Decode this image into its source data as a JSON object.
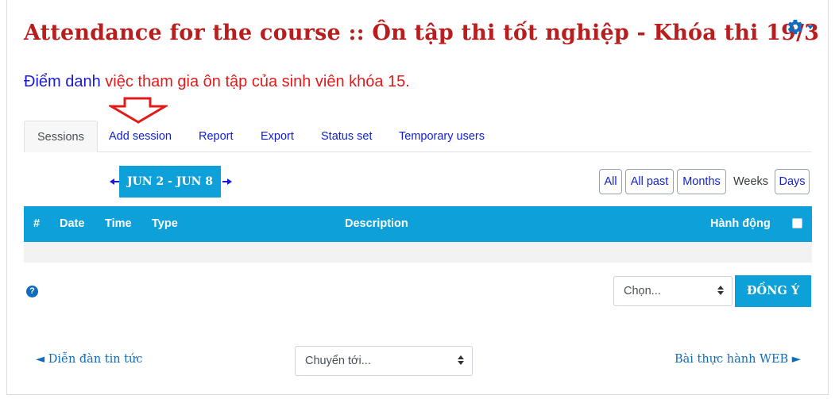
{
  "page": {
    "title": "Attendance for the course :: Ôn tập thi tốt nghiệp - Khóa thi 19/3",
    "subtitle_blue": "Điểm danh",
    "subtitle_red": " việc tham gia ôn tập của sinh viên khóa 15."
  },
  "tabs": [
    {
      "label": "Sessions",
      "active": true
    },
    {
      "label": "Add session"
    },
    {
      "label": "Report"
    },
    {
      "label": "Export"
    },
    {
      "label": "Status set"
    },
    {
      "label": "Temporary users"
    }
  ],
  "week_nav": {
    "label": "JUN 2 - JUN 8",
    "prev_icon": "arrow-left-icon",
    "next_icon": "arrow-right-icon"
  },
  "view_options": {
    "all": "All",
    "all_past": "All past",
    "months": "Months",
    "weeks": "Weeks",
    "days": "Days",
    "selected": "Weeks"
  },
  "table": {
    "headers": {
      "num": "#",
      "date": "Date",
      "time": "Time",
      "type": "Type",
      "description": "Description",
      "actions": "Hành động"
    }
  },
  "actions": {
    "select_value": "Chọn...",
    "ok_label": "ĐỒNG Ý"
  },
  "footer": {
    "prev_link": "◄ Diễn đàn tin tức",
    "jump_select": "Chuyển tới...",
    "next_link": "Bài thực hành WEB ►"
  },
  "colors": {
    "accent": "#0ea0d8",
    "title_red": "#b81e1e",
    "link_blue": "#0f1fd4",
    "annotation_red": "#e01b1b"
  }
}
